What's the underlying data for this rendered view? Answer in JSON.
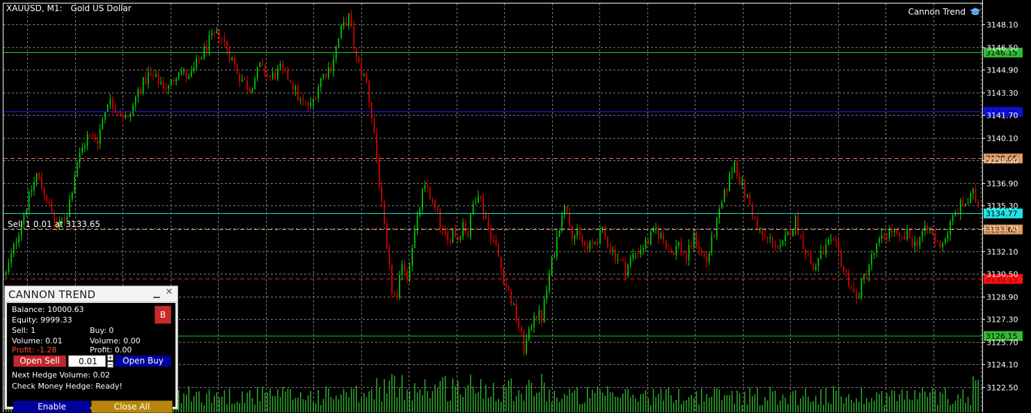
{
  "header": {
    "symbol": "XAUUSD, M1:",
    "description": "Gold US Dollar"
  },
  "brand": {
    "label": "Cannon Trend",
    "icon": "graduation-cap-icon"
  },
  "colors": {
    "background": "#000000",
    "grid": "#7f7f7f",
    "bull": "#00dd00",
    "bear": "#ee0000",
    "volume": "#2fae2f",
    "axis_text": "#ffffff"
  },
  "price_axis": {
    "ticks": [
      "3148.10",
      "3146.50",
      "3144.90",
      "3143.30",
      "3141.70",
      "3140.10",
      "3138.50",
      "3136.90",
      "3135.30",
      "3133.70",
      "3132.10",
      "3130.50",
      "3128.90",
      "3127.30",
      "3125.70",
      "3124.10",
      "3122.50"
    ],
    "tick_values": [
      3148.1,
      3146.5,
      3144.9,
      3143.3,
      3141.7,
      3140.1,
      3138.5,
      3136.9,
      3135.3,
      3133.7,
      3132.1,
      3130.5,
      3128.9,
      3127.3,
      3125.7,
      3124.1,
      3122.5
    ],
    "ylim": [
      3121.7,
      3148.9
    ]
  },
  "levels": [
    {
      "label": "3146.15",
      "value": 3146.15,
      "line_color": "#2ecc2e",
      "box_color": "#33bb33",
      "text_color": "#000000",
      "style": "solid"
    },
    {
      "label": "3141.95",
      "value": 3141.95,
      "line_color": "#1f1fff",
      "box_color": "#1010d0",
      "text_color": "#0000aa",
      "style": "solid"
    },
    {
      "label": "3138.65",
      "value": 3138.65,
      "line_color": "#e08060",
      "box_color": "#e39a5b",
      "text_color": "#000000",
      "style": "dashed"
    },
    {
      "label": "3134.77",
      "value": 3134.77,
      "line_color": "#22dddd",
      "box_color": "#22e6e6",
      "text_color": "#000000",
      "style": "solid"
    },
    {
      "label": "3133.65",
      "value": 3133.65,
      "line_color": "#e39a5b",
      "box_color": "#e39a5b",
      "text_color": "#000000",
      "style": "dashed"
    },
    {
      "label": "3130.15",
      "value": 3130.15,
      "line_color": "#ff2020",
      "box_color": "#ff1010",
      "text_color": "#770000",
      "style": "dashed"
    },
    {
      "label": "3126.15",
      "value": 3126.15,
      "line_color": "#22bb22",
      "box_color": "#33bb33",
      "text_color": "#000000",
      "style": "solid"
    }
  ],
  "trade_label": "Sell 1 0.01 at 3133.65",
  "price_path": [
    [
      0,
      3130.5
    ],
    [
      6,
      3134.2
    ],
    [
      12,
      3137.5
    ],
    [
      16,
      3135.8
    ],
    [
      20,
      3133.6
    ],
    [
      24,
      3134.8
    ],
    [
      28,
      3138.4
    ],
    [
      32,
      3140.2
    ],
    [
      36,
      3140.0
    ],
    [
      40,
      3142.8
    ],
    [
      44,
      3142.1
    ],
    [
      48,
      3141.3
    ],
    [
      52,
      3143.4
    ],
    [
      56,
      3144.5
    ],
    [
      60,
      3144.1
    ],
    [
      64,
      3143.6
    ],
    [
      68,
      3145.0
    ],
    [
      72,
      3144.2
    ],
    [
      76,
      3145.6
    ],
    [
      80,
      3146.9
    ],
    [
      84,
      3147.5
    ],
    [
      88,
      3146.0
    ],
    [
      92,
      3144.4
    ],
    [
      96,
      3143.6
    ],
    [
      100,
      3145.1
    ],
    [
      104,
      3144.3
    ],
    [
      108,
      3144.9
    ],
    [
      112,
      3144.2
    ],
    [
      116,
      3142.6
    ],
    [
      120,
      3142.3
    ],
    [
      124,
      3144.3
    ],
    [
      128,
      3145.2
    ],
    [
      132,
      3147.7
    ],
    [
      135,
      3148.6
    ],
    [
      138,
      3145.6
    ],
    [
      142,
      3144.0
    ],
    [
      145,
      3140.4
    ],
    [
      148,
      3135.2
    ],
    [
      150,
      3132.0
    ],
    [
      152,
      3129.4
    ],
    [
      154,
      3128.5
    ],
    [
      156,
      3131.5
    ],
    [
      158,
      3130.3
    ],
    [
      160,
      3132.6
    ],
    [
      162,
      3134.2
    ],
    [
      164,
      3136.2
    ],
    [
      166,
      3136.6
    ],
    [
      168,
      3135.4
    ],
    [
      170,
      3134.7
    ],
    [
      172,
      3133.3
    ],
    [
      174,
      3132.7
    ],
    [
      176,
      3133.6
    ],
    [
      178,
      3133.0
    ],
    [
      180,
      3134.1
    ],
    [
      182,
      3133.3
    ],
    [
      184,
      3135.4
    ],
    [
      186,
      3136.4
    ],
    [
      188,
      3135.0
    ],
    [
      190,
      3133.8
    ],
    [
      193,
      3132.4
    ],
    [
      196,
      3130.2
    ],
    [
      199,
      3128.6
    ],
    [
      202,
      3126.8
    ],
    [
      204,
      3125.2
    ],
    [
      206,
      3126.2
    ],
    [
      208,
      3127.8
    ],
    [
      211,
      3127.4
    ],
    [
      214,
      3130.4
    ],
    [
      217,
      3133.0
    ],
    [
      219,
      3135.0
    ],
    [
      221,
      3135.1
    ],
    [
      223,
      3133.4
    ],
    [
      226,
      3133.0
    ],
    [
      229,
      3132.2
    ],
    [
      232,
      3132.8
    ],
    [
      235,
      3133.4
    ],
    [
      238,
      3132.4
    ],
    [
      241,
      3131.6
    ],
    [
      244,
      3130.8
    ],
    [
      247,
      3131.8
    ],
    [
      250,
      3132.3
    ],
    [
      253,
      3132.8
    ],
    [
      256,
      3133.6
    ],
    [
      259,
      3132.9
    ],
    [
      262,
      3132.0
    ],
    [
      265,
      3132.6
    ],
    [
      268,
      3131.6
    ],
    [
      271,
      3133.1
    ],
    [
      274,
      3132.0
    ],
    [
      276,
      3131.4
    ],
    [
      279,
      3133.4
    ],
    [
      282,
      3135.4
    ],
    [
      285,
      3137.3
    ],
    [
      287,
      3138.4
    ],
    [
      289,
      3137.1
    ],
    [
      291,
      3136.2
    ],
    [
      293,
      3135.4
    ],
    [
      296,
      3133.6
    ],
    [
      299,
      3133.0
    ],
    [
      302,
      3132.8
    ],
    [
      305,
      3132.2
    ],
    [
      308,
      3133.2
    ],
    [
      311,
      3134.3
    ],
    [
      313,
      3133.1
    ],
    [
      315,
      3132.2
    ],
    [
      318,
      3130.8
    ],
    [
      321,
      3131.8
    ],
    [
      324,
      3132.6
    ],
    [
      327,
      3132.4
    ],
    [
      330,
      3130.8
    ],
    [
      333,
      3129.6
    ],
    [
      335,
      3128.6
    ],
    [
      338,
      3130.3
    ],
    [
      340,
      3131.2
    ],
    [
      343,
      3132.4
    ],
    [
      346,
      3133.2
    ],
    [
      349,
      3133.6
    ],
    [
      352,
      3132.8
    ],
    [
      355,
      3133.2
    ],
    [
      358,
      3132.6
    ],
    [
      361,
      3133.4
    ],
    [
      364,
      3133.6
    ],
    [
      367,
      3132.5
    ],
    [
      370,
      3133.0
    ],
    [
      373,
      3134.4
    ],
    [
      376,
      3135.3
    ],
    [
      379,
      3135.6
    ],
    [
      381,
      3136.1
    ],
    [
      383,
      3135.4
    ]
  ],
  "panel": {
    "title": "CANNON TREND",
    "b_button": "B",
    "balance": "Balance: 10000.63",
    "equity": "Equity: 9999.33",
    "sell": "Sell: 1",
    "buy": "Buy: 0",
    "sell_volume": "Volume: 0.01",
    "buy_volume": "Volume: 0.00",
    "sell_profit": "Profit: -1.28",
    "buy_profit": "Profit: 0.00",
    "open_sell": "Open Sell",
    "volume_input": "0.01",
    "open_buy": "Open Buy",
    "next_hedge": "Next Hedge Volume: 0.02",
    "check_money": "Check Money Hedge: Ready!",
    "enable": "Enable",
    "close_all": "Close All"
  }
}
